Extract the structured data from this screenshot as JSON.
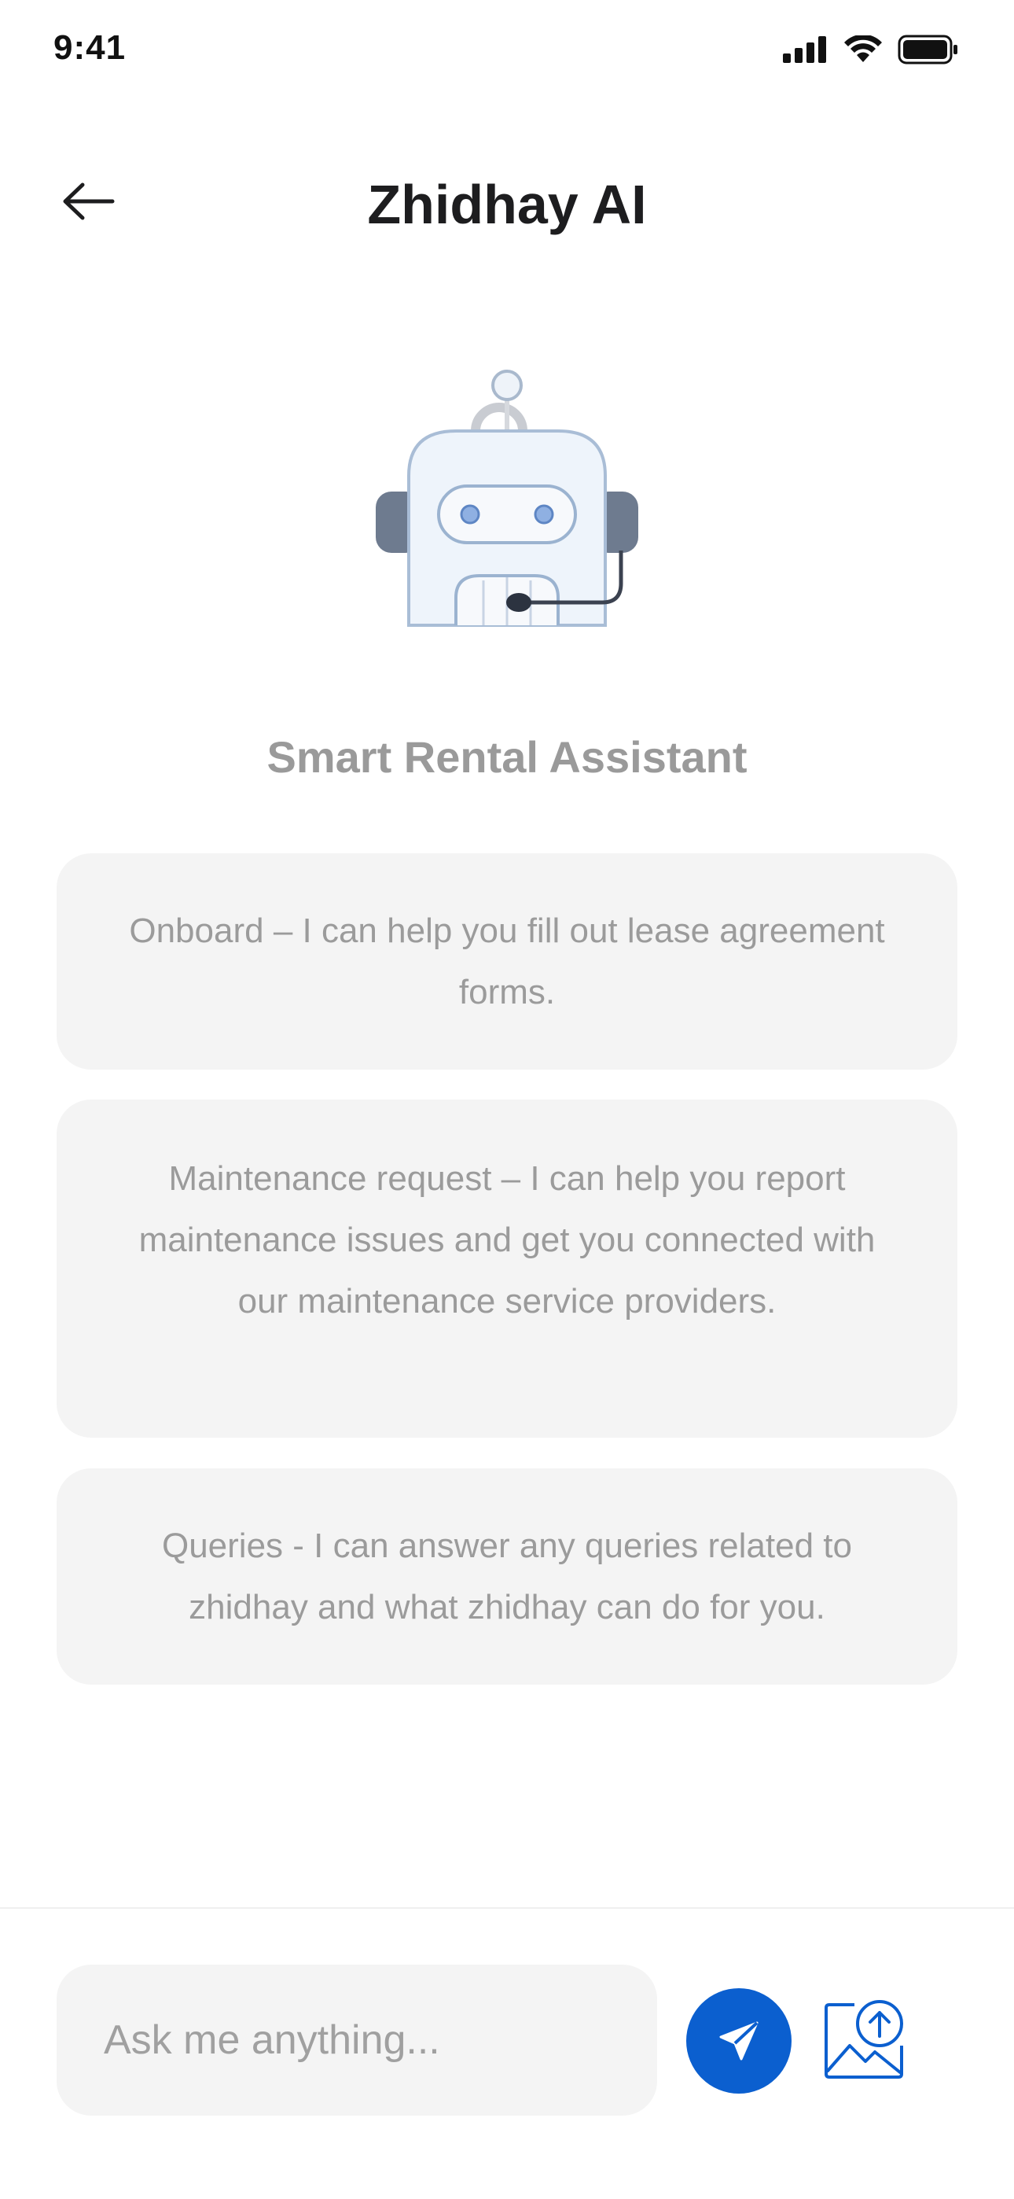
{
  "status_bar": {
    "time": "9:41",
    "icons": [
      "cellular-signal-icon",
      "wifi-icon",
      "battery-icon"
    ]
  },
  "header": {
    "title": "Zhidhay AI",
    "back_icon": "arrow-left-icon"
  },
  "assistant": {
    "illustration": "robot-support-icon",
    "subtitle": "Smart Rental Assistant"
  },
  "cards": [
    {
      "text": "Onboard – I can help you fill out lease agreement forms."
    },
    {
      "text": "Maintenance request –  I can help you report maintenance issues and get you connected with our maintenance service providers."
    },
    {
      "text": "Queries - I can answer any queries related to zhidhay and what zhidhay can do for you."
    }
  ],
  "composer": {
    "placeholder": "Ask me anything...",
    "value": "",
    "send_icon": "paper-plane-icon",
    "upload_icon": "image-upload-icon"
  },
  "colors": {
    "accent": "#0B5FCF",
    "card_bg": "#F4F4F4",
    "muted_text": "#9B9B9B",
    "title_text": "#1D1D1F"
  }
}
